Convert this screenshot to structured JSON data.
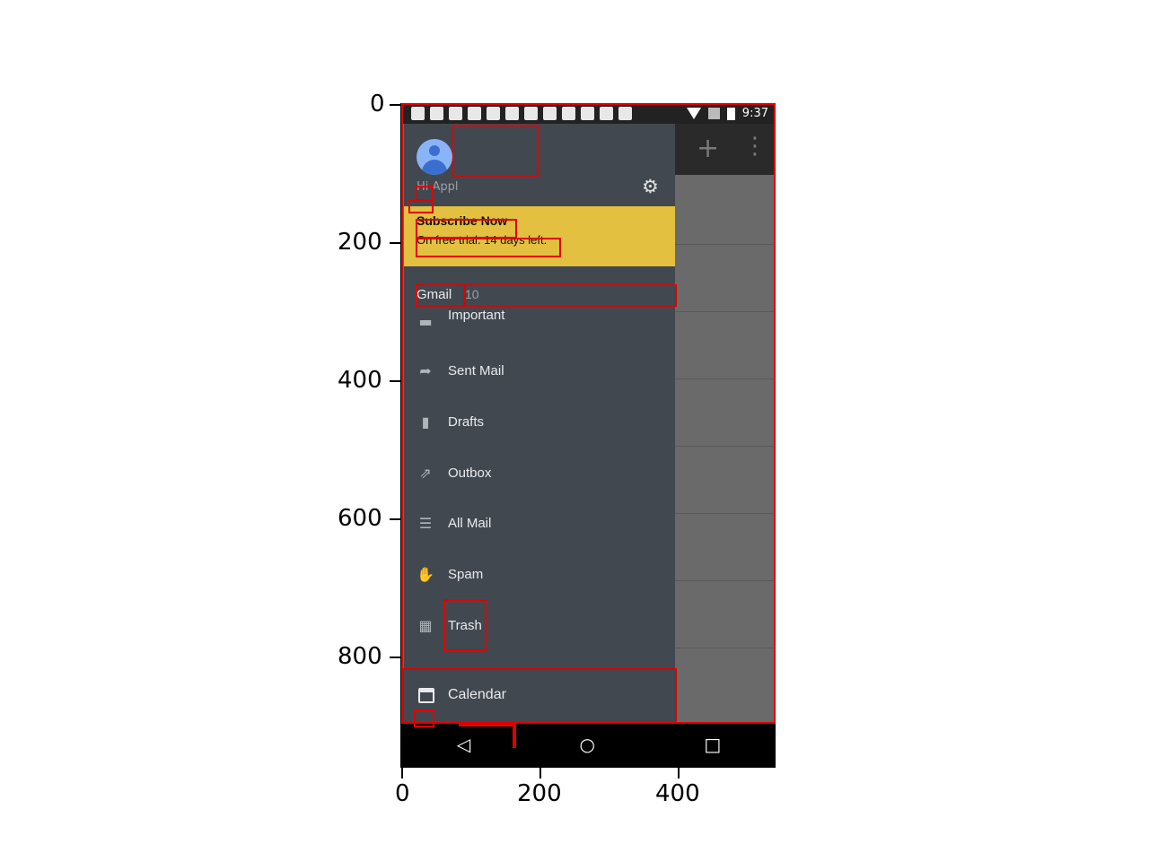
{
  "axes": {
    "yticks": [
      "0",
      "200",
      "400",
      "600",
      "800"
    ],
    "xticks": [
      "0",
      "200",
      "400"
    ]
  },
  "status_bar": {
    "time": "9:37"
  },
  "drawer": {
    "account_name": "Hi Appl",
    "banner": {
      "title": "Subscribe Now",
      "subtitle": "On free trial. 14 days left."
    },
    "folder_header": {
      "label": "Gmail",
      "count": "10"
    },
    "items": [
      {
        "label": "Important",
        "icon": "label-icon"
      },
      {
        "label": "Sent Mail",
        "icon": "send-icon"
      },
      {
        "label": "Drafts",
        "icon": "draft-icon"
      },
      {
        "label": "Outbox",
        "icon": "outbox-icon"
      },
      {
        "label": "All Mail",
        "icon": "all-mail-icon"
      },
      {
        "label": "Spam",
        "icon": "spam-icon"
      },
      {
        "label": "Trash",
        "icon": "trash-icon"
      }
    ],
    "calendar": {
      "label": "Calendar",
      "icon": "calendar-icon"
    }
  },
  "app_toolbar": {
    "add_symbol": "+",
    "menu_symbol": "⋮"
  },
  "nav_bar": {
    "back": "◁",
    "home": "○",
    "recents": "□"
  },
  "colors": {
    "drawer": "#424850",
    "banner": "#e3c040",
    "annotation": "#e00000"
  }
}
